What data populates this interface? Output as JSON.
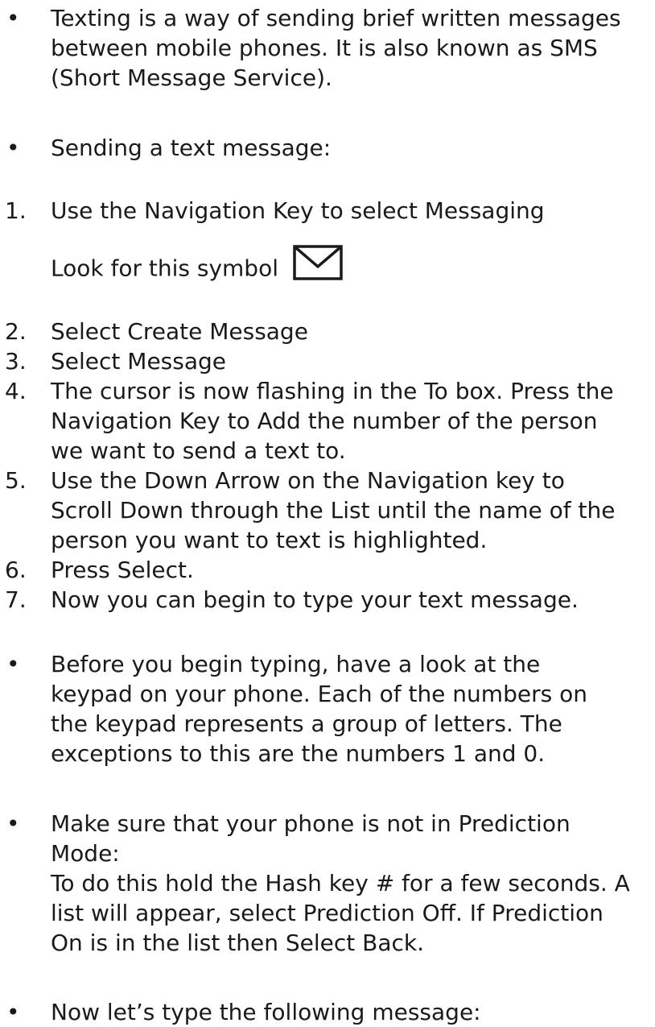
{
  "intro": {
    "marker": "•",
    "text": "Texting is a way of sending brief written messages\nbetween mobile phones. It is also known as SMS\n(Short Message Service)."
  },
  "sending": {
    "marker": "•",
    "text": "Sending a text message:"
  },
  "steps": [
    {
      "marker": "1.",
      "text": "Use the Navigation Key to select Messaging"
    },
    {
      "marker": "2.",
      "text": "Select Create Message"
    },
    {
      "marker": "3.",
      "text": "Select Message"
    },
    {
      "marker": "4.",
      "text": "The cursor is now flashing in the To box. Press the\nNavigation Key to Add the number of the person\nwe want to send a text to."
    },
    {
      "marker": "5.",
      "text": "Use the Down Arrow on the Navigation key to\nScroll Down through the List until the name of the\nperson you want to text is highlighted."
    },
    {
      "marker": "6.",
      "text": "Press Select."
    },
    {
      "marker": "7.",
      "text": "Now you can begin to type your text message."
    }
  ],
  "symbol_hint": {
    "text": "Look for this symbol",
    "icon": "envelope-icon"
  },
  "keypad": {
    "marker": "•",
    "text": "Before you begin typing, have a look at the\nkeypad on your phone. Each of the numbers on\nthe keypad represents a group of letters. The\nexceptions to this are the numbers 1 and 0."
  },
  "prediction": {
    "marker": "•",
    "text": "Make sure that your phone is not in Prediction\nMode:\nTo do this hold the Hash key # for a few seconds. A\nlist will appear, select Prediction Off. If Prediction\nOn is in the list then Select Back."
  },
  "final": {
    "marker": "•",
    "text": "Now let’s type the following message:"
  }
}
